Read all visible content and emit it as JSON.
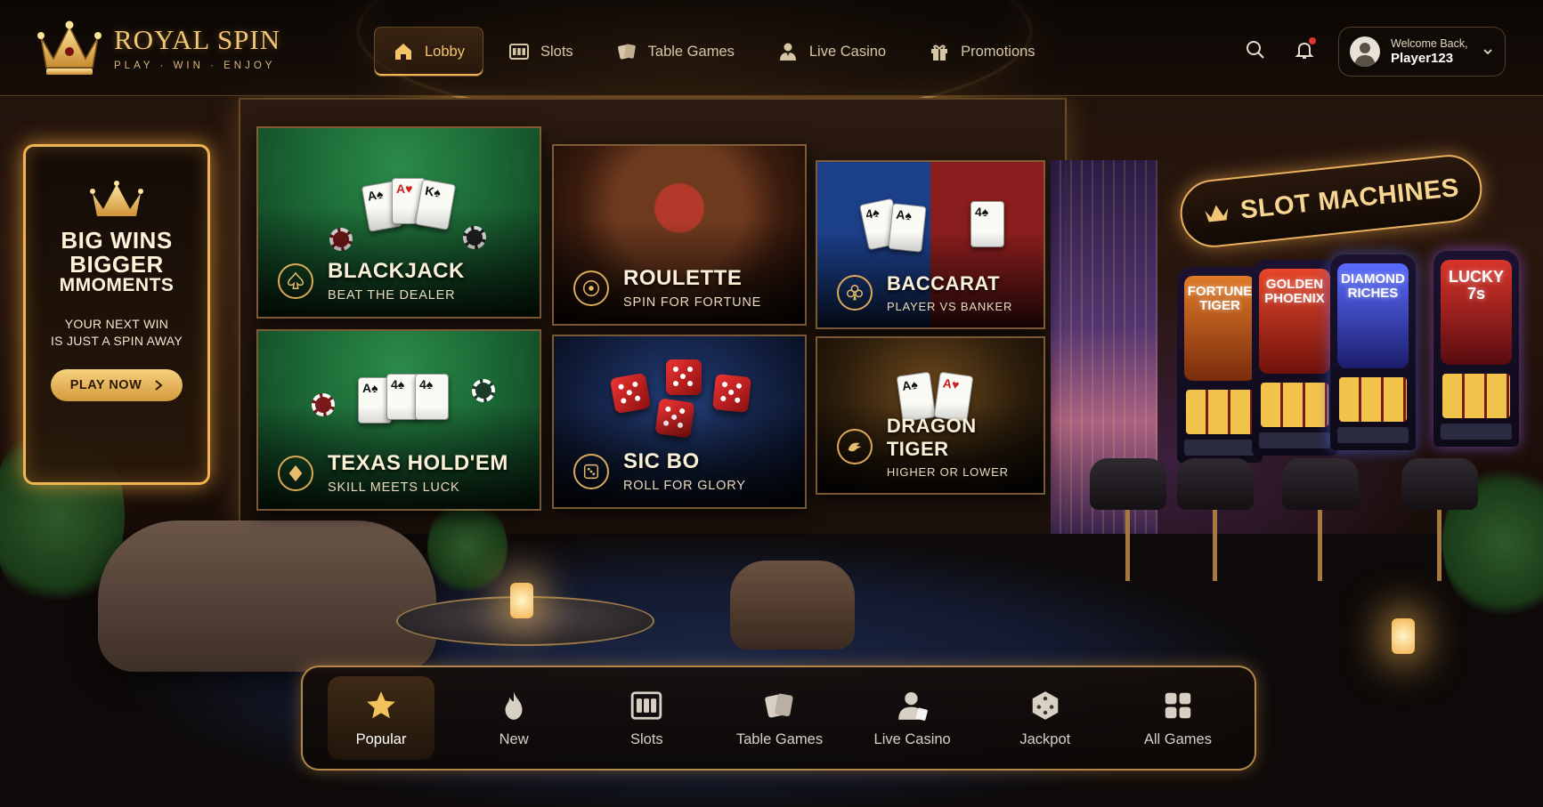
{
  "brand": {
    "name": "ROYAL SPIN",
    "tagline": "PLAY · WIN · ENJOY"
  },
  "nav": {
    "items": [
      {
        "label": "Lobby",
        "icon": "home-icon",
        "active": true
      },
      {
        "label": "Slots",
        "icon": "slot-machine-icon",
        "active": false
      },
      {
        "label": "Table Games",
        "icon": "cards-icon",
        "active": false
      },
      {
        "label": "Live Casino",
        "icon": "dealer-icon",
        "active": false
      },
      {
        "label": "Promotions",
        "icon": "gift-icon",
        "active": false
      }
    ]
  },
  "header_tools": {
    "search_icon": "search-icon",
    "notifications_icon": "bell-icon",
    "has_unread": true
  },
  "user": {
    "greeting": "Welcome Back,",
    "username": "Player123",
    "avatar_icon": "user-avatar-icon"
  },
  "promo": {
    "title_line1": "BIG WINS",
    "title_line2": "BIGGER",
    "title_line3": "MMOMENTS",
    "subtitle_line1": "YOUR NEXT WIN",
    "subtitle_line2": "IS JUST A SPIN AWAY",
    "cta": "PLAY NOW",
    "cta_icon": "chevron-right-icon"
  },
  "games": [
    {
      "name": "BLACKJACK",
      "tagline": "BEAT THE DEALER",
      "icon": "spade-icon"
    },
    {
      "name": "ROULETTE",
      "tagline": "SPIN FOR FORTUNE",
      "icon": "roulette-icon"
    },
    {
      "name": "BACCARAT",
      "tagline": "PLAYER VS BANKER",
      "icon": "club-icon"
    },
    {
      "name": "TEXAS HOLD'EM",
      "tagline": "SKILL MEETS LUCK",
      "icon": "diamond-icon"
    },
    {
      "name": "SIC BO",
      "tagline": "ROLL FOR GLORY",
      "icon": "dice-icon"
    },
    {
      "name": "DRAGON TIGER",
      "tagline": "HIGHER OR LOWER",
      "icon": "dragon-icon"
    }
  ],
  "slot_area": {
    "sign": "SLOT MACHINES",
    "machines": [
      {
        "title_line1": "FORTUNE",
        "title_line2": "TIGER",
        "color": "#b8551b"
      },
      {
        "title_line1": "GOLDEN",
        "title_line2": "PHOENIX",
        "color": "#c2331f"
      },
      {
        "title_line1": "DIAMOND",
        "title_line2": "RICHES",
        "color": "#3b4cc9"
      },
      {
        "title_line1": "LUCKY",
        "title_line2": "7s",
        "color": "#c72a2a"
      }
    ]
  },
  "categories": [
    {
      "label": "Popular",
      "icon": "star-icon",
      "active": true
    },
    {
      "label": "New",
      "icon": "flame-icon",
      "active": false
    },
    {
      "label": "Slots",
      "icon": "slot-machine-icon",
      "active": false
    },
    {
      "label": "Table Games",
      "icon": "cards-icon",
      "active": false
    },
    {
      "label": "Live Casino",
      "icon": "dealer-icon",
      "active": false
    },
    {
      "label": "Jackpot",
      "icon": "dice-icon",
      "active": false
    },
    {
      "label": "All Games",
      "icon": "grid-icon",
      "active": false
    }
  ],
  "colors": {
    "gold": "#f0b552",
    "gold_light": "#f6d690",
    "notification": "#e0342f",
    "panel": "#120a06"
  }
}
